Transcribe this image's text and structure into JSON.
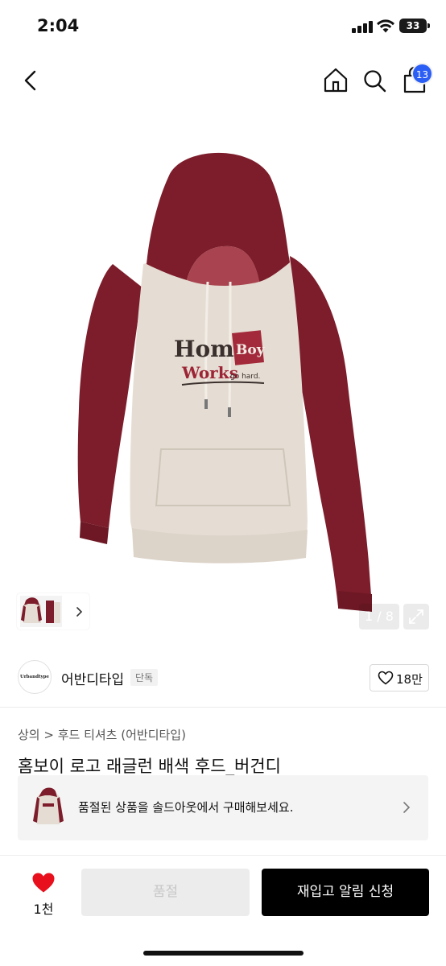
{
  "status": {
    "time": "2:04",
    "battery": "33"
  },
  "header": {
    "cart_count": "13",
    "icons": [
      "back-icon",
      "home-icon",
      "search-icon",
      "cart-icon"
    ]
  },
  "gallery": {
    "page_indicator": "1 / 8",
    "icons": [
      "chevron-right-icon",
      "expand-icon"
    ]
  },
  "brand": {
    "logo_text": "Urbandtype",
    "name": "어반디타입",
    "tag": "단독",
    "like_count": "18만"
  },
  "product": {
    "breadcrumb": "상의 > 후드 티셔츠 (어반디타입)",
    "title": "홈보이 로고 래글런 배색 후드_버건디"
  },
  "soldout_banner": {
    "text": "품절된 상품을 솔드아웃에서 구매해보세요."
  },
  "bottom_bar": {
    "fav_count": "1천",
    "soldout_label": "품절",
    "restock_label": "재입고 알림 신청"
  },
  "colors": {
    "accent_blue": "#2b5ef5",
    "heart_red": "#e8101d",
    "burgundy": "#7d1d2b",
    "cream": "#e5ddd3"
  },
  "hoodie_print": {
    "home": "Home",
    "boy": "Boy",
    "works": "Works",
    "slogan": "go hard."
  }
}
